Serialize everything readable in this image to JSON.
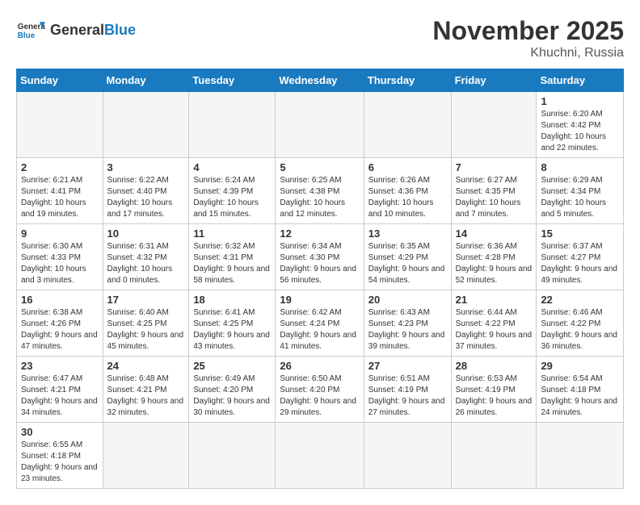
{
  "header": {
    "logo_general": "General",
    "logo_blue": "Blue",
    "month_year": "November 2025",
    "location": "Khuchni, Russia"
  },
  "weekdays": [
    "Sunday",
    "Monday",
    "Tuesday",
    "Wednesday",
    "Thursday",
    "Friday",
    "Saturday"
  ],
  "weeks": [
    [
      {
        "day": "",
        "sunrise": "",
        "sunset": "",
        "daylight": ""
      },
      {
        "day": "",
        "sunrise": "",
        "sunset": "",
        "daylight": ""
      },
      {
        "day": "",
        "sunrise": "",
        "sunset": "",
        "daylight": ""
      },
      {
        "day": "",
        "sunrise": "",
        "sunset": "",
        "daylight": ""
      },
      {
        "day": "",
        "sunrise": "",
        "sunset": "",
        "daylight": ""
      },
      {
        "day": "",
        "sunrise": "",
        "sunset": "",
        "daylight": ""
      },
      {
        "day": "1",
        "sunrise": "Sunrise: 6:20 AM",
        "sunset": "Sunset: 4:42 PM",
        "daylight": "Daylight: 10 hours and 22 minutes."
      }
    ],
    [
      {
        "day": "2",
        "sunrise": "Sunrise: 6:21 AM",
        "sunset": "Sunset: 4:41 PM",
        "daylight": "Daylight: 10 hours and 19 minutes."
      },
      {
        "day": "3",
        "sunrise": "Sunrise: 6:22 AM",
        "sunset": "Sunset: 4:40 PM",
        "daylight": "Daylight: 10 hours and 17 minutes."
      },
      {
        "day": "4",
        "sunrise": "Sunrise: 6:24 AM",
        "sunset": "Sunset: 4:39 PM",
        "daylight": "Daylight: 10 hours and 15 minutes."
      },
      {
        "day": "5",
        "sunrise": "Sunrise: 6:25 AM",
        "sunset": "Sunset: 4:38 PM",
        "daylight": "Daylight: 10 hours and 12 minutes."
      },
      {
        "day": "6",
        "sunrise": "Sunrise: 6:26 AM",
        "sunset": "Sunset: 4:36 PM",
        "daylight": "Daylight: 10 hours and 10 minutes."
      },
      {
        "day": "7",
        "sunrise": "Sunrise: 6:27 AM",
        "sunset": "Sunset: 4:35 PM",
        "daylight": "Daylight: 10 hours and 7 minutes."
      },
      {
        "day": "8",
        "sunrise": "Sunrise: 6:29 AM",
        "sunset": "Sunset: 4:34 PM",
        "daylight": "Daylight: 10 hours and 5 minutes."
      }
    ],
    [
      {
        "day": "9",
        "sunrise": "Sunrise: 6:30 AM",
        "sunset": "Sunset: 4:33 PM",
        "daylight": "Daylight: 10 hours and 3 minutes."
      },
      {
        "day": "10",
        "sunrise": "Sunrise: 6:31 AM",
        "sunset": "Sunset: 4:32 PM",
        "daylight": "Daylight: 10 hours and 0 minutes."
      },
      {
        "day": "11",
        "sunrise": "Sunrise: 6:32 AM",
        "sunset": "Sunset: 4:31 PM",
        "daylight": "Daylight: 9 hours and 58 minutes."
      },
      {
        "day": "12",
        "sunrise": "Sunrise: 6:34 AM",
        "sunset": "Sunset: 4:30 PM",
        "daylight": "Daylight: 9 hours and 56 minutes."
      },
      {
        "day": "13",
        "sunrise": "Sunrise: 6:35 AM",
        "sunset": "Sunset: 4:29 PM",
        "daylight": "Daylight: 9 hours and 54 minutes."
      },
      {
        "day": "14",
        "sunrise": "Sunrise: 6:36 AM",
        "sunset": "Sunset: 4:28 PM",
        "daylight": "Daylight: 9 hours and 52 minutes."
      },
      {
        "day": "15",
        "sunrise": "Sunrise: 6:37 AM",
        "sunset": "Sunset: 4:27 PM",
        "daylight": "Daylight: 9 hours and 49 minutes."
      }
    ],
    [
      {
        "day": "16",
        "sunrise": "Sunrise: 6:38 AM",
        "sunset": "Sunset: 4:26 PM",
        "daylight": "Daylight: 9 hours and 47 minutes."
      },
      {
        "day": "17",
        "sunrise": "Sunrise: 6:40 AM",
        "sunset": "Sunset: 4:25 PM",
        "daylight": "Daylight: 9 hours and 45 minutes."
      },
      {
        "day": "18",
        "sunrise": "Sunrise: 6:41 AM",
        "sunset": "Sunset: 4:25 PM",
        "daylight": "Daylight: 9 hours and 43 minutes."
      },
      {
        "day": "19",
        "sunrise": "Sunrise: 6:42 AM",
        "sunset": "Sunset: 4:24 PM",
        "daylight": "Daylight: 9 hours and 41 minutes."
      },
      {
        "day": "20",
        "sunrise": "Sunrise: 6:43 AM",
        "sunset": "Sunset: 4:23 PM",
        "daylight": "Daylight: 9 hours and 39 minutes."
      },
      {
        "day": "21",
        "sunrise": "Sunrise: 6:44 AM",
        "sunset": "Sunset: 4:22 PM",
        "daylight": "Daylight: 9 hours and 37 minutes."
      },
      {
        "day": "22",
        "sunrise": "Sunrise: 6:46 AM",
        "sunset": "Sunset: 4:22 PM",
        "daylight": "Daylight: 9 hours and 36 minutes."
      }
    ],
    [
      {
        "day": "23",
        "sunrise": "Sunrise: 6:47 AM",
        "sunset": "Sunset: 4:21 PM",
        "daylight": "Daylight: 9 hours and 34 minutes."
      },
      {
        "day": "24",
        "sunrise": "Sunrise: 6:48 AM",
        "sunset": "Sunset: 4:21 PM",
        "daylight": "Daylight: 9 hours and 32 minutes."
      },
      {
        "day": "25",
        "sunrise": "Sunrise: 6:49 AM",
        "sunset": "Sunset: 4:20 PM",
        "daylight": "Daylight: 9 hours and 30 minutes."
      },
      {
        "day": "26",
        "sunrise": "Sunrise: 6:50 AM",
        "sunset": "Sunset: 4:20 PM",
        "daylight": "Daylight: 9 hours and 29 minutes."
      },
      {
        "day": "27",
        "sunrise": "Sunrise: 6:51 AM",
        "sunset": "Sunset: 4:19 PM",
        "daylight": "Daylight: 9 hours and 27 minutes."
      },
      {
        "day": "28",
        "sunrise": "Sunrise: 6:53 AM",
        "sunset": "Sunset: 4:19 PM",
        "daylight": "Daylight: 9 hours and 26 minutes."
      },
      {
        "day": "29",
        "sunrise": "Sunrise: 6:54 AM",
        "sunset": "Sunset: 4:18 PM",
        "daylight": "Daylight: 9 hours and 24 minutes."
      }
    ],
    [
      {
        "day": "30",
        "sunrise": "Sunrise: 6:55 AM",
        "sunset": "Sunset: 4:18 PM",
        "daylight": "Daylight: 9 hours and 23 minutes."
      },
      {
        "day": "",
        "sunrise": "",
        "sunset": "",
        "daylight": ""
      },
      {
        "day": "",
        "sunrise": "",
        "sunset": "",
        "daylight": ""
      },
      {
        "day": "",
        "sunrise": "",
        "sunset": "",
        "daylight": ""
      },
      {
        "day": "",
        "sunrise": "",
        "sunset": "",
        "daylight": ""
      },
      {
        "day": "",
        "sunrise": "",
        "sunset": "",
        "daylight": ""
      },
      {
        "day": "",
        "sunrise": "",
        "sunset": "",
        "daylight": ""
      }
    ]
  ]
}
